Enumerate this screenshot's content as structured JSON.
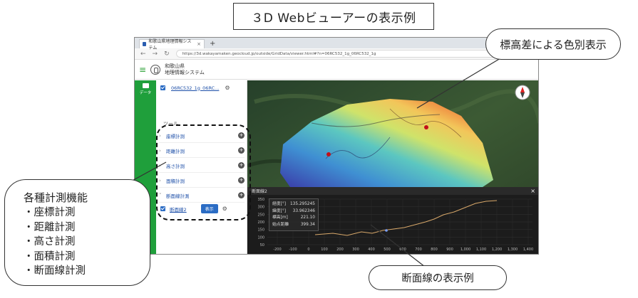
{
  "title": "３D Webビューアーの表示例",
  "browser": {
    "tab_title": "和歌山県地理情報システム",
    "tab_close": "×",
    "new_tab": "+",
    "win_min": "—",
    "win_max": "□",
    "win_close": "×",
    "url": "https://3d.wakayamaken.geocloud.jp/outside/GridData/viewer.html#?n=06RC532_1g_06RC532_1g"
  },
  "app": {
    "header_title_line1": "和歌山県",
    "header_title_line2": "地理情報システム",
    "rail_data_label": "データ",
    "layer_name": "06RC532_1g_06RC...",
    "tools_label": "ツール",
    "tools": [
      {
        "label": "座標計測"
      },
      {
        "label": "距離計測"
      },
      {
        "label": "高さ計測"
      },
      {
        "label": "面積計測"
      },
      {
        "label": "断面線計測"
      }
    ],
    "profile_layer_name": "断面線2",
    "show_button": "表示"
  },
  "profile": {
    "header": "断面線2",
    "close": "×",
    "tooltip": {
      "lon_label": "経度[°]",
      "lon_value": "135.295245",
      "lat_label": "緯度[°]",
      "lat_value": "33.962346",
      "elev_label": "標高[m]",
      "elev_value": "221.10",
      "dist_label": "始点距離",
      "dist_value": "399.34"
    },
    "y_ticks": [
      "350",
      "300",
      "250",
      "200",
      "150",
      "100",
      "50"
    ],
    "x_ticks": [
      "-200",
      "-100",
      "0",
      "100",
      "200",
      "300",
      "400",
      "500",
      "600",
      "700",
      "800",
      "900",
      "1,000",
      "1,100",
      "1,200",
      "1,300",
      "1,400"
    ]
  },
  "callouts": {
    "elevation": "標高差による色別表示",
    "tools_title": "各種計測機能",
    "tools_items": [
      "・座標計測",
      "・距離計測",
      "・高さ計測",
      "・面積計測",
      "・断面線計測"
    ],
    "profile": "断面線の表示例"
  },
  "colors": {
    "rail_green": "#1f9f3b",
    "accent_blue": "#2b6cc4",
    "profile_bg": "#1c1c1c"
  }
}
